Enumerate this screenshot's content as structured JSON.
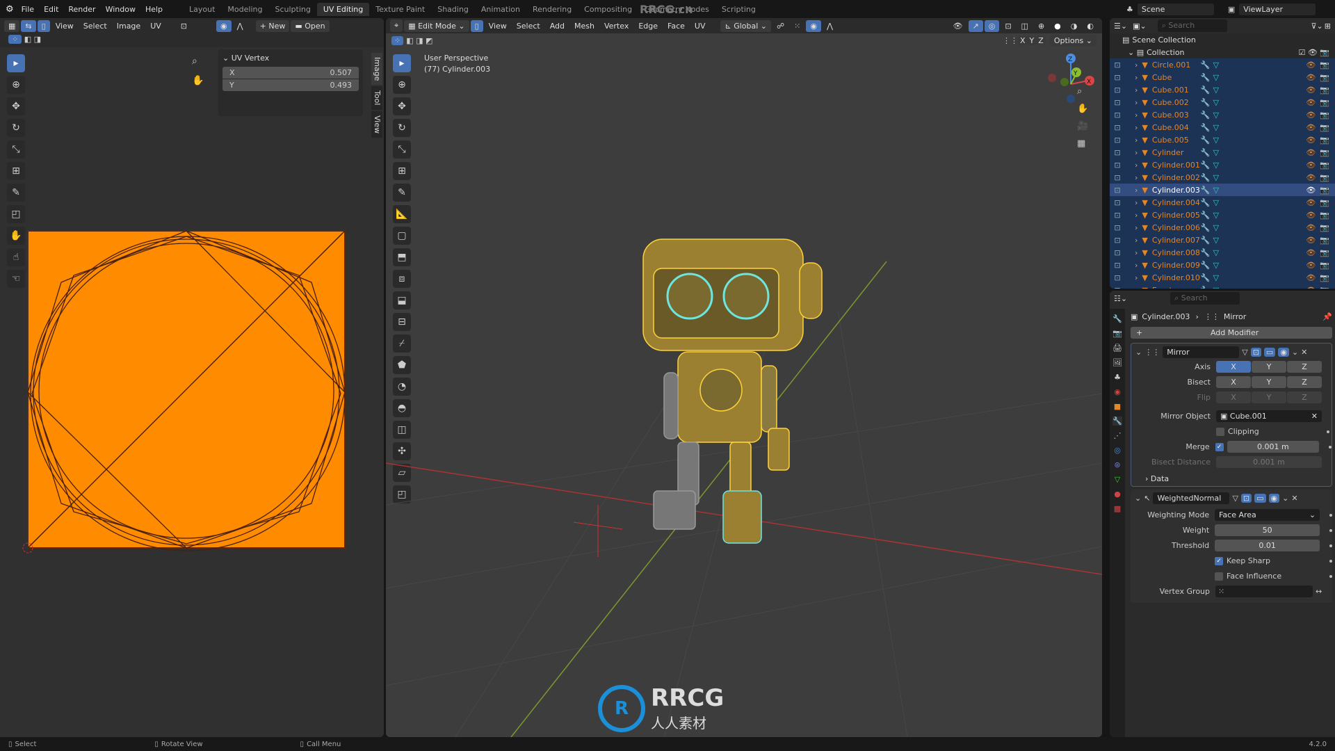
{
  "menu": [
    "File",
    "Edit",
    "Render",
    "Window",
    "Help"
  ],
  "workspaces": [
    "Layout",
    "Modeling",
    "Sculpting",
    "UV Editing",
    "Texture Paint",
    "Shading",
    "Animation",
    "Rendering",
    "Compositing",
    "Geometry Nodes",
    "Scripting"
  ],
  "active_workspace": "UV Editing",
  "scene": {
    "name": "Scene",
    "view_layer": "ViewLayer"
  },
  "uv_editor": {
    "menus": [
      "View",
      "Select",
      "Image",
      "UV"
    ],
    "new": "New",
    "open": "Open",
    "panel": {
      "title": "UV Vertex",
      "x_label": "X",
      "x_value": "0.507",
      "y_label": "Y",
      "y_value": "0.493"
    },
    "tabs": [
      "Image",
      "Tool",
      "View"
    ],
    "uv_fill": "#ff8c00"
  },
  "viewport": {
    "mode": "Edit Mode",
    "menus": [
      "View",
      "Select",
      "Add",
      "Mesh",
      "Vertex",
      "Edge",
      "Face",
      "UV"
    ],
    "orientation": "Global",
    "options": "Options",
    "axes": [
      "X",
      "Y",
      "Z"
    ],
    "overlay_title": "User Perspective",
    "overlay_object": "(77) Cylinder.003",
    "gizmo": {
      "z": "Z",
      "y": "Y",
      "x": "X"
    }
  },
  "outliner": {
    "search_placeholder": "Search",
    "scene_collection": "Scene Collection",
    "collection": "Collection",
    "items": [
      "Circle.001",
      "Cube",
      "Cube.001",
      "Cube.002",
      "Cube.003",
      "Cube.004",
      "Cube.005",
      "Cylinder",
      "Cylinder.001",
      "Cylinder.002",
      "Cylinder.003",
      "Cylinder.004",
      "Cylinder.005",
      "Cylinder.006",
      "Cylinder.007",
      "Cylinder.008",
      "Cylinder.009",
      "Cylinder.010",
      "Empty"
    ],
    "selected": "Cylinder.003"
  },
  "properties": {
    "search_placeholder": "Search",
    "breadcrumb_object": "Cylinder.003",
    "breadcrumb_modifier": "Mirror",
    "add_modifier": "Add Modifier",
    "mirror": {
      "name": "Mirror",
      "axis_label": "Axis",
      "bisect_label": "Bisect",
      "flip_label": "Flip",
      "xyz": [
        "X",
        "Y",
        "Z"
      ],
      "mirror_object_label": "Mirror Object",
      "mirror_object": "Cube.001",
      "clipping": "Clipping",
      "clipping_checked": false,
      "merge_label": "Merge",
      "merge_checked": true,
      "merge_value": "0.001 m",
      "bisect_distance_label": "Bisect Distance",
      "bisect_distance": "0.001 m",
      "data": "Data"
    },
    "weighted_normal": {
      "name": "WeightedNormal",
      "mode_label": "Weighting Mode",
      "mode": "Face Area",
      "weight_label": "Weight",
      "weight": "50",
      "threshold_label": "Threshold",
      "threshold": "0.01",
      "keep_sharp": "Keep Sharp",
      "keep_sharp_checked": true,
      "face_influence": "Face Influence",
      "face_influence_checked": false,
      "vertex_group_label": "Vertex Group"
    }
  },
  "status": {
    "select": "Select",
    "rotate": "Rotate View",
    "call_menu": "Call Menu",
    "version": "4.2.0"
  },
  "watermark": {
    "logo_text": "RRCG",
    "logo_sub": "人人素材",
    "top": "RRCG.cn"
  },
  "colors": {
    "accent": "#4772b3",
    "object_name": "#e2862a",
    "wire": "#ffd23c",
    "selected_row": "#334d80"
  }
}
